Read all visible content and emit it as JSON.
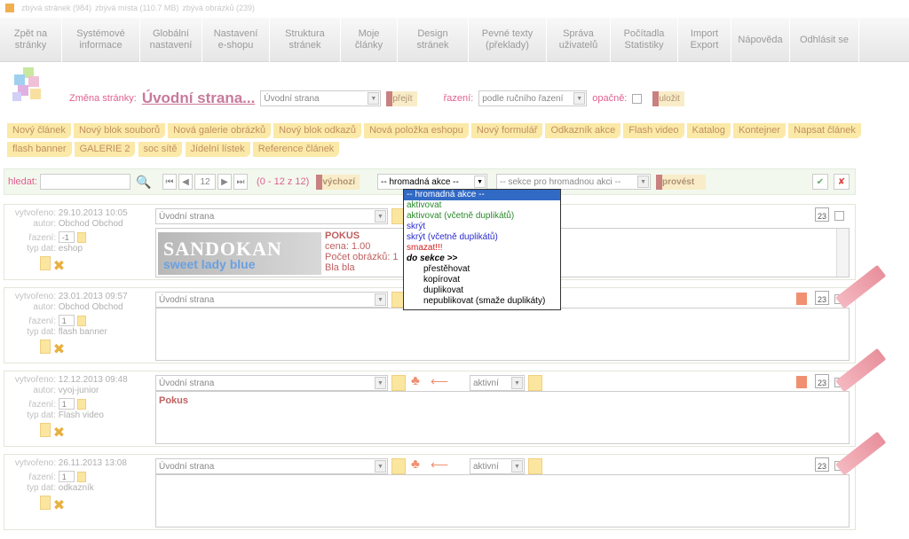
{
  "stats": {
    "pages": "zbývá stránek (984)",
    "space": "zbývá místa (110.7 MB)",
    "images": "zbývá obrázků (239)"
  },
  "nav": [
    "Zpět na\nstránky",
    "Systémové\ninformace",
    "Globální\nnastavení",
    "Nastavení\ne-shopu",
    "Struktura\nstránek",
    "Moje\nčlánky",
    "Design\nstránek",
    "Pevné texty\n(překlady)",
    "Správa\nuživatelů",
    "Počítadla\nStatistiky",
    "Import\nExport",
    "Nápověda",
    "Odhlásit se"
  ],
  "change_page": {
    "label": "Změna stránky:",
    "title": "Úvodní strana...",
    "select": "Úvodní strana",
    "go": "přejít",
    "sort_label": "řazení:",
    "sort_value": "podle ručního řazení",
    "reverse_label": "opačně:",
    "save": "uložit"
  },
  "new_items": [
    "Nový článek",
    "Nový blok souborů",
    "Nová galerie obrázků",
    "Nový blok odkazů",
    "Nová položka eshopu",
    "Nový formulář",
    "Odkazník akce",
    "Flash video",
    "Katalog",
    "Kontejner",
    "Napsat článek",
    "flash banner",
    "GALERIE 2",
    "soc sítě",
    "Jídelní lístek",
    "Reference článek"
  ],
  "toolbar": {
    "search_label": "hledat:",
    "page": "12",
    "range": "(0 - 12 z 12)",
    "default": "výchozí",
    "bulk_select": "-- hromadná akce --",
    "section_select": "-- sekce pro hromadnou akci --",
    "execute": "provést"
  },
  "bulk_menu": [
    {
      "label": "-- hromadná akce --",
      "color": "#ffffff",
      "bg": "#316ac5",
      "bold": false,
      "indent": false
    },
    {
      "label": "aktivovat",
      "color": "#2a8a2a",
      "bg": "",
      "bold": false,
      "indent": false
    },
    {
      "label": "aktivovat (včetně duplikátů)",
      "color": "#2a8a2a",
      "bg": "",
      "bold": false,
      "indent": false
    },
    {
      "label": "skrýt",
      "color": "#2a2ad0",
      "bg": "",
      "bold": false,
      "indent": false
    },
    {
      "label": "skrýt (včetně duplikátů)",
      "color": "#2a2ad0",
      "bg": "",
      "bold": false,
      "indent": false
    },
    {
      "label": "smazat!!!",
      "color": "#d02020",
      "bg": "",
      "bold": false,
      "indent": false
    },
    {
      "label": "do sekce >>",
      "color": "#000000",
      "bg": "",
      "bold": true,
      "indent": false
    },
    {
      "label": "přestěhovat",
      "color": "#000000",
      "bg": "",
      "bold": false,
      "indent": true
    },
    {
      "label": "kopírovat",
      "color": "#000000",
      "bg": "",
      "bold": false,
      "indent": true
    },
    {
      "label": "duplikovat",
      "color": "#000000",
      "bg": "",
      "bold": false,
      "indent": true
    },
    {
      "label": "nepublikovat (smaže duplikáty)",
      "color": "#000000",
      "bg": "",
      "bold": false,
      "indent": true
    }
  ],
  "keys": {
    "created": "vytvořeno:",
    "author": "autor:",
    "order": "řazení:",
    "type": "typ dat:"
  },
  "calendar": "23",
  "rows": [
    {
      "created": "29.10.2013 10:05",
      "author": "Obchod Obchod",
      "order": "-1",
      "type": "eshop",
      "section": "Úvodní strana",
      "status": "",
      "banner": "SANDOKAN",
      "banner_sub": "sweet lady blue",
      "product_title": "POKUS",
      "product_lines": [
        "cena: 1.00",
        "Počet obrázků: 1",
        "Bla bla"
      ],
      "content": ""
    },
    {
      "created": "23.01.2013 09:57",
      "author": "Obchod Obchod",
      "order": "1",
      "type": "flash banner",
      "section": "Úvodní strana",
      "status": "",
      "content": ""
    },
    {
      "created": "12.12.2013 09:48",
      "author": "vyoj-junior",
      "order": "1",
      "type": "Flash video",
      "section": "Úvodní strana",
      "status": "aktivní",
      "content": "Pokus"
    },
    {
      "created": "26.11.2013 13:08",
      "author": "",
      "order": "1",
      "type": "odkazník",
      "section": "Úvodní strana",
      "status": "aktivní",
      "content": ""
    }
  ]
}
